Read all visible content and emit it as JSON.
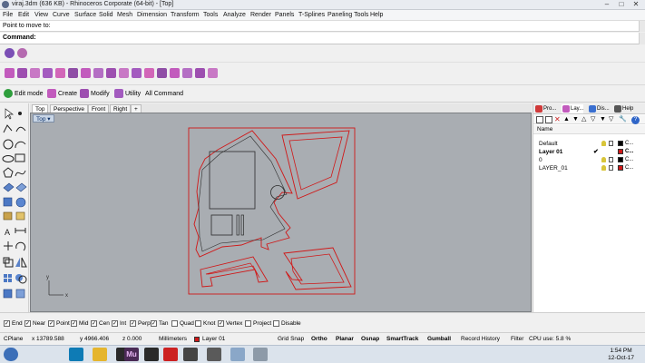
{
  "window": {
    "title": "viraj.3dm (636 KB) - Rhinoceros Corporate (64-bit) - [Top]"
  },
  "menu": [
    "File",
    "Edit",
    "View",
    "Curve",
    "Surface",
    "Solid",
    "Mesh",
    "Dimension",
    "Transform",
    "Tools",
    "Analyze",
    "Render",
    "Panels",
    "T-Splines",
    "Paneling Tools",
    "Help"
  ],
  "command": {
    "history": "Point to move to:",
    "prompt": "Command:"
  },
  "tabs": [
    "Edit mode",
    "Create",
    "Modify",
    "Utility",
    "All Command"
  ],
  "viewport_tabs": [
    "Top",
    "Perspective",
    "Front",
    "Right",
    "+"
  ],
  "viewport_label": "Top",
  "panel": {
    "tabs": [
      "Pro...",
      "Lay...",
      "Dis...",
      "Help"
    ],
    "column_header": "Name",
    "layers": [
      {
        "name": "Default",
        "current": false,
        "color": "#000000",
        "material": "C..."
      },
      {
        "name": "Layer 01",
        "current": true,
        "color": "#d01818",
        "material": "C..."
      },
      {
        "name": "0",
        "current": false,
        "color": "#000000",
        "material": "C..."
      },
      {
        "name": "LAYER_01",
        "current": false,
        "color": "#d01818",
        "material": "C..."
      }
    ]
  },
  "osnap": [
    {
      "label": "End",
      "checked": true
    },
    {
      "label": "Near",
      "checked": true
    },
    {
      "label": "Point",
      "checked": true
    },
    {
      "label": "Mid",
      "checked": true
    },
    {
      "label": "Cen",
      "checked": true
    },
    {
      "label": "Int",
      "checked": true
    },
    {
      "label": "Perp",
      "checked": true
    },
    {
      "label": "Tan",
      "checked": true
    },
    {
      "label": "Quad",
      "checked": false
    },
    {
      "label": "Knot",
      "checked": false
    },
    {
      "label": "Vertex",
      "checked": true
    },
    {
      "label": "Project",
      "checked": false
    },
    {
      "label": "Disable",
      "checked": false
    }
  ],
  "status": {
    "cplane": "CPlane",
    "x": "x 13789.588",
    "y": "y 4966.406",
    "z": "z 0.000",
    "units": "Millimeters",
    "layer": "Layer 01",
    "layer_color": "#d01818",
    "toggles": [
      "Grid Snap",
      "Ortho",
      "Planar",
      "Osnap",
      "SmartTrack",
      "Gumball",
      "Record History",
      "Filter"
    ],
    "cpu": "CPU use: 5.8 %"
  },
  "taskbar": {
    "time": "1:54 PM",
    "date": "12-Oct-17"
  },
  "colors": {
    "curve": "#d01818",
    "viewport_bg": "#a9adb2",
    "geometry": "#2a2a2a"
  }
}
